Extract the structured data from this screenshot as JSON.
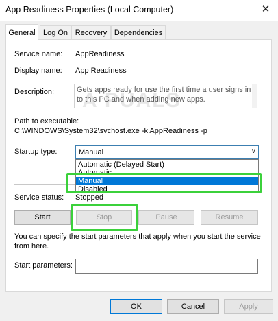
{
  "window": {
    "title": "App Readiness Properties (Local Computer)",
    "close_glyph": "✕"
  },
  "tabs": [
    {
      "label": "General",
      "active": true
    },
    {
      "label": "Log On",
      "active": false
    },
    {
      "label": "Recovery",
      "active": false
    },
    {
      "label": "Dependencies",
      "active": false
    }
  ],
  "general": {
    "service_name_label": "Service name:",
    "service_name_value": "AppReadiness",
    "display_name_label": "Display name:",
    "display_name_value": "App Readiness",
    "description_label": "Description:",
    "description_value": "Gets apps ready for use the first time a user signs in to this PC and when adding new apps.",
    "path_label": "Path to executable:",
    "path_value": "C:\\WINDOWS\\System32\\svchost.exe -k AppReadiness -p",
    "startup_type_label": "Startup type:",
    "startup_type_value": "Manual",
    "startup_options": [
      "Automatic (Delayed Start)",
      "Automatic",
      "Manual",
      "Disabled"
    ],
    "service_status_label": "Service status:",
    "service_status_value": "Stopped",
    "start_label": "Start",
    "stop_label": "Stop",
    "pause_label": "Pause",
    "resume_label": "Resume",
    "hint_text": "You can specify the start parameters that apply when you start the service from here.",
    "start_params_label": "Start parameters:",
    "start_params_value": ""
  },
  "footer": {
    "ok_label": "OK",
    "cancel_label": "Cancel",
    "apply_label": "Apply"
  },
  "watermark": "A  PUALS",
  "colors": {
    "highlight": "#3bd13b",
    "selection": "#0078d7"
  }
}
